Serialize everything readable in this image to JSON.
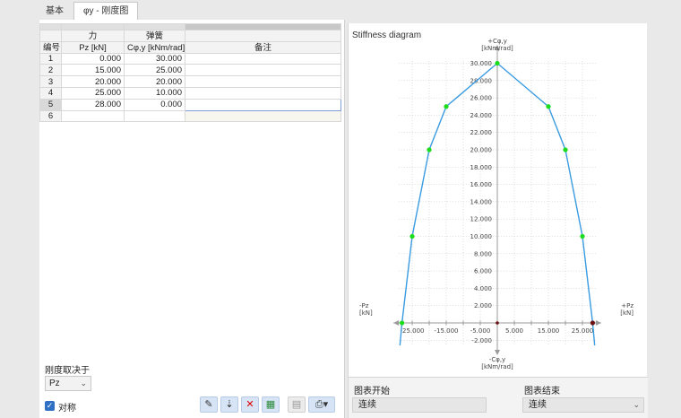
{
  "tabs": [
    {
      "label": "基本",
      "active": false
    },
    {
      "label": "φy - 刚度图",
      "active": true
    }
  ],
  "table": {
    "group_headers": {
      "force": "力",
      "spring": "弹簧"
    },
    "columns": {
      "no": "编号",
      "pz": "Pz [kN]",
      "c": "Cφ,y [kNm/rad]",
      "note": "备注"
    },
    "rows": [
      {
        "no": "1",
        "pz": "0.000",
        "c": "30.000",
        "note": ""
      },
      {
        "no": "2",
        "pz": "15.000",
        "c": "25.000",
        "note": ""
      },
      {
        "no": "3",
        "pz": "20.000",
        "c": "20.000",
        "note": ""
      },
      {
        "no": "4",
        "pz": "25.000",
        "c": "10.000",
        "note": ""
      },
      {
        "no": "5",
        "pz": "28.000",
        "c": "0.000",
        "note": ""
      },
      {
        "no": "6",
        "pz": "",
        "c": "",
        "note": ""
      }
    ],
    "selected_row": 4
  },
  "depends": {
    "label": "刚度取决于",
    "value": "Pz"
  },
  "symmetric": {
    "label": "对称",
    "checked": true
  },
  "toolbar": {
    "icons": [
      "edit-icon",
      "sort-icon",
      "delete-icon",
      "import-excel-icon",
      "export-icon",
      "print-icon"
    ]
  },
  "diagram": {
    "title": "Stiffness diagram",
    "y_pos_label": [
      "+Cφ,y",
      "[kNm/rad]"
    ],
    "y_neg_label": [
      "-Cφ,y",
      "[kNm/rad]"
    ],
    "x_pos_label": [
      "+Pz",
      "[kN]"
    ],
    "x_neg_label": [
      "-Pz",
      "[kN]"
    ],
    "y_ticks": [
      "30.000",
      "28.000",
      "26.000",
      "24.000",
      "22.000",
      "20.000",
      "18.000",
      "16.000",
      "14.000",
      "12.000",
      "10.000",
      "8.000",
      "6.000",
      "4.000",
      "2.000",
      "-2.000"
    ],
    "x_ticks": [
      "-25.000",
      "-15.000",
      "-5.000",
      "5.000",
      "15.000",
      "25.000"
    ]
  },
  "chart_data": {
    "type": "line",
    "x": [
      -28,
      -25,
      -20,
      -15,
      0,
      15,
      20,
      25,
      28
    ],
    "series": [
      {
        "values": [
          0,
          10,
          20,
          25,
          30,
          25,
          20,
          10,
          0
        ]
      }
    ],
    "title": "Stiffness diagram",
    "xlabel": "Pz [kN]",
    "ylabel": "Cφ,y [kNm/rad]",
    "xlim": [
      -29,
      29
    ],
    "ylim": [
      -2,
      31
    ],
    "grid": true,
    "colors": {
      "line": "#3a9be0",
      "point": "#1ddc1d",
      "end_point": "#6b1010"
    }
  },
  "diagram_footer": {
    "start_label": "图表开始",
    "start_value": "连续",
    "end_label": "图表结束",
    "end_value": "连续"
  }
}
